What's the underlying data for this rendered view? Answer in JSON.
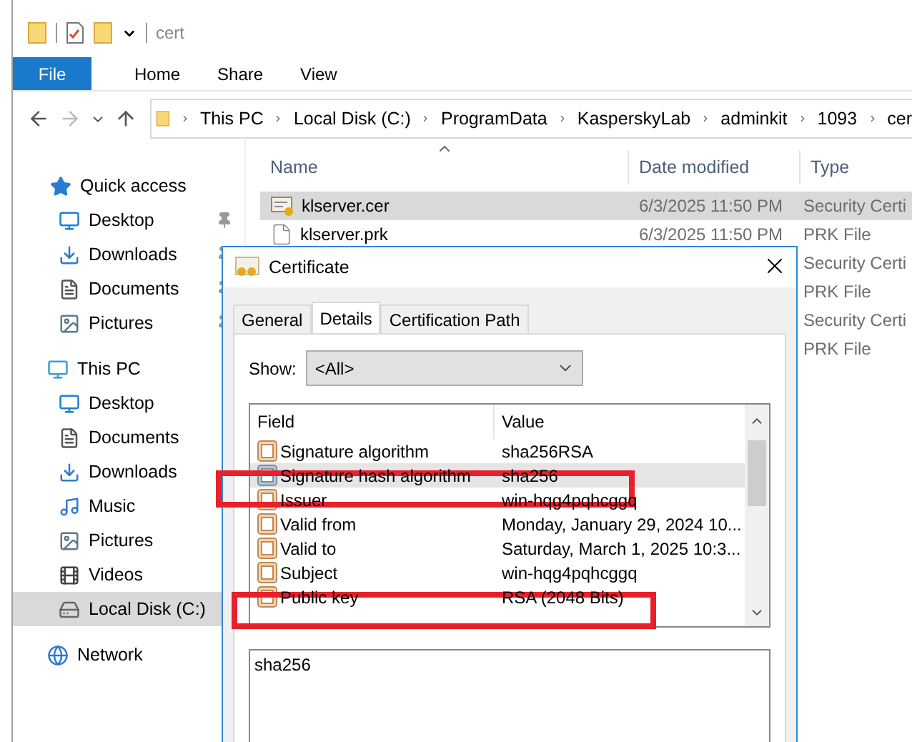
{
  "window": {
    "title": "cert"
  },
  "ribbon": {
    "file_button": "File",
    "tabs": [
      "Home",
      "Share",
      "View"
    ]
  },
  "address_bar": {
    "path": [
      "This PC",
      "Local Disk (C:)",
      "ProgramData",
      "KasperskyLab",
      "adminkit",
      "1093",
      "cer"
    ]
  },
  "sidebar": [
    {
      "label": "Quick access",
      "kind": "star",
      "selected": false,
      "children": [
        {
          "label": "Desktop",
          "kind": "desktop",
          "pinned": true,
          "selected": false
        },
        {
          "label": "Downloads",
          "kind": "downloads",
          "pinned": true,
          "selected": false
        },
        {
          "label": "Documents",
          "kind": "documents",
          "pinned": true,
          "selected": false
        },
        {
          "label": "Pictures",
          "kind": "pictures",
          "pinned": true,
          "selected": false
        }
      ]
    },
    {
      "label": "This PC",
      "kind": "pc",
      "selected": false,
      "children": [
        {
          "label": "Desktop",
          "kind": "desktop",
          "pinned": false,
          "selected": false
        },
        {
          "label": "Documents",
          "kind": "documents",
          "pinned": false,
          "selected": false
        },
        {
          "label": "Downloads",
          "kind": "downloads",
          "pinned": false,
          "selected": false
        },
        {
          "label": "Music",
          "kind": "music",
          "pinned": false,
          "selected": false
        },
        {
          "label": "Pictures",
          "kind": "pictures",
          "pinned": false,
          "selected": false
        },
        {
          "label": "Videos",
          "kind": "videos",
          "pinned": false,
          "selected": false
        },
        {
          "label": "Local Disk (C:)",
          "kind": "drive",
          "pinned": false,
          "selected": true
        }
      ]
    },
    {
      "label": "Network",
      "kind": "network",
      "selected": false
    }
  ],
  "file_list": {
    "columns": [
      "Name",
      "Date modified",
      "Type"
    ],
    "rows": [
      {
        "name": "klserver.cer",
        "date": "6/3/2025 11:50 PM",
        "type": "Security Certi",
        "kind": "certificate",
        "selected": true
      },
      {
        "name": "klserver.prk",
        "date": "6/3/2025 11:50 PM",
        "type": "PRK File",
        "kind": "file",
        "selected": false
      },
      {
        "type": "Security Certi",
        "selected": false
      },
      {
        "type": "PRK File",
        "selected": false
      },
      {
        "type": "Security Certi",
        "selected": false
      },
      {
        "type": "PRK File",
        "selected": false
      }
    ]
  },
  "dialog": {
    "title": "Certificate",
    "tabs": [
      {
        "label": "General",
        "selected": false
      },
      {
        "label": "Details",
        "selected": true
      },
      {
        "label": "Certification Path",
        "selected": false
      }
    ],
    "show_label": "Show:",
    "show_value": "<All>",
    "columns": [
      "Field",
      "Value"
    ],
    "rows": [
      {
        "field": "Signature algorithm",
        "value": "sha256RSA",
        "selected": false,
        "highlighted": false
      },
      {
        "field": "Signature hash algorithm",
        "value": "sha256",
        "selected": true,
        "highlighted": true
      },
      {
        "field": "Issuer",
        "value": "win-hqg4pqhcggq",
        "selected": false,
        "highlighted": false
      },
      {
        "field": "Valid from",
        "value": "Monday, January 29, 2024 10...",
        "selected": false,
        "highlighted": false
      },
      {
        "field": "Valid to",
        "value": "Saturday, March 1, 2025 10:3...",
        "selected": false,
        "highlighted": false
      },
      {
        "field": "Subject",
        "value": "win-hqg4pqhcggq",
        "selected": false,
        "highlighted": false
      },
      {
        "field": "Public key",
        "value": "RSA (2048 Bits)",
        "selected": false,
        "highlighted": true
      }
    ],
    "detail_value": "sha256"
  }
}
